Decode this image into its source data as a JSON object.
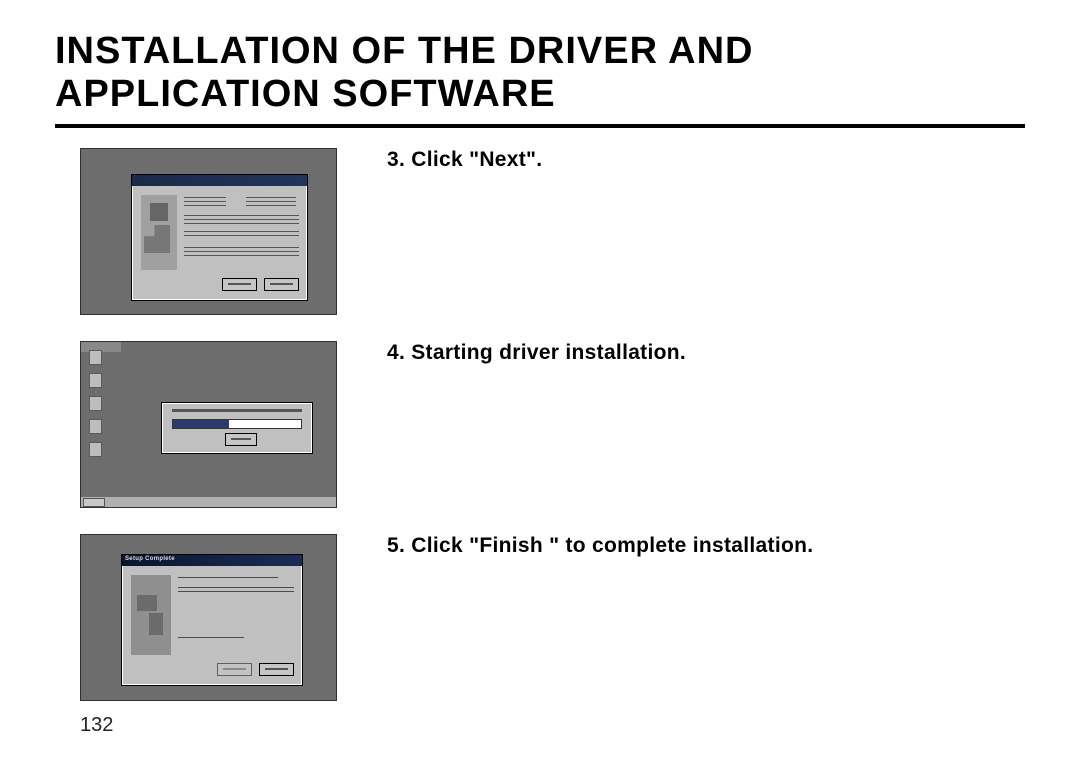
{
  "page": {
    "heading": "INSTALLATION OF THE DRIVER AND APPLICATION SOFTWARE",
    "page_number": "132"
  },
  "steps": [
    {
      "label": "3. Click \"Next\"."
    },
    {
      "label": "4. Starting driver installation."
    },
    {
      "label": "5. Click \"Finish \" to complete installation."
    }
  ],
  "window3": {
    "title": "Setup Complete"
  }
}
